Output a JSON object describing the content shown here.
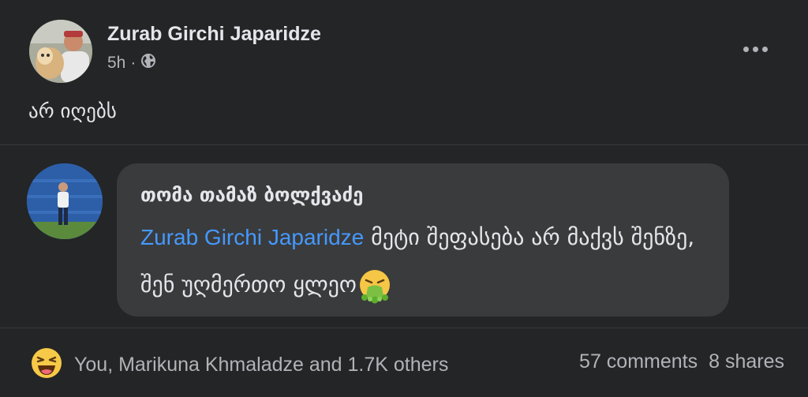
{
  "post": {
    "author": "Zurab Girchi Japaridze",
    "time": "5h",
    "separator": "·",
    "privacy_icon": "globe-icon",
    "text": "არ იღებს"
  },
  "comment": {
    "author": "თომა თამაზ ბოლქვაძე",
    "mention": "Zurab Girchi Japaridze",
    "text": "მეტი შეფასება არ მაქვს შენზე, შენ უღმერთო ყლეო",
    "emoji": "nauseated-face-icon"
  },
  "footer": {
    "reaction_icon": "haha-reaction-icon",
    "reactions_text": "You, Marikuna Khmaladze and 1.7K others",
    "comments": "57 comments",
    "shares": "8 shares"
  },
  "colors": {
    "background": "#242526",
    "bubble": "#3a3b3c",
    "mention": "#4599ff",
    "secondary_text": "#b0b3b8"
  }
}
